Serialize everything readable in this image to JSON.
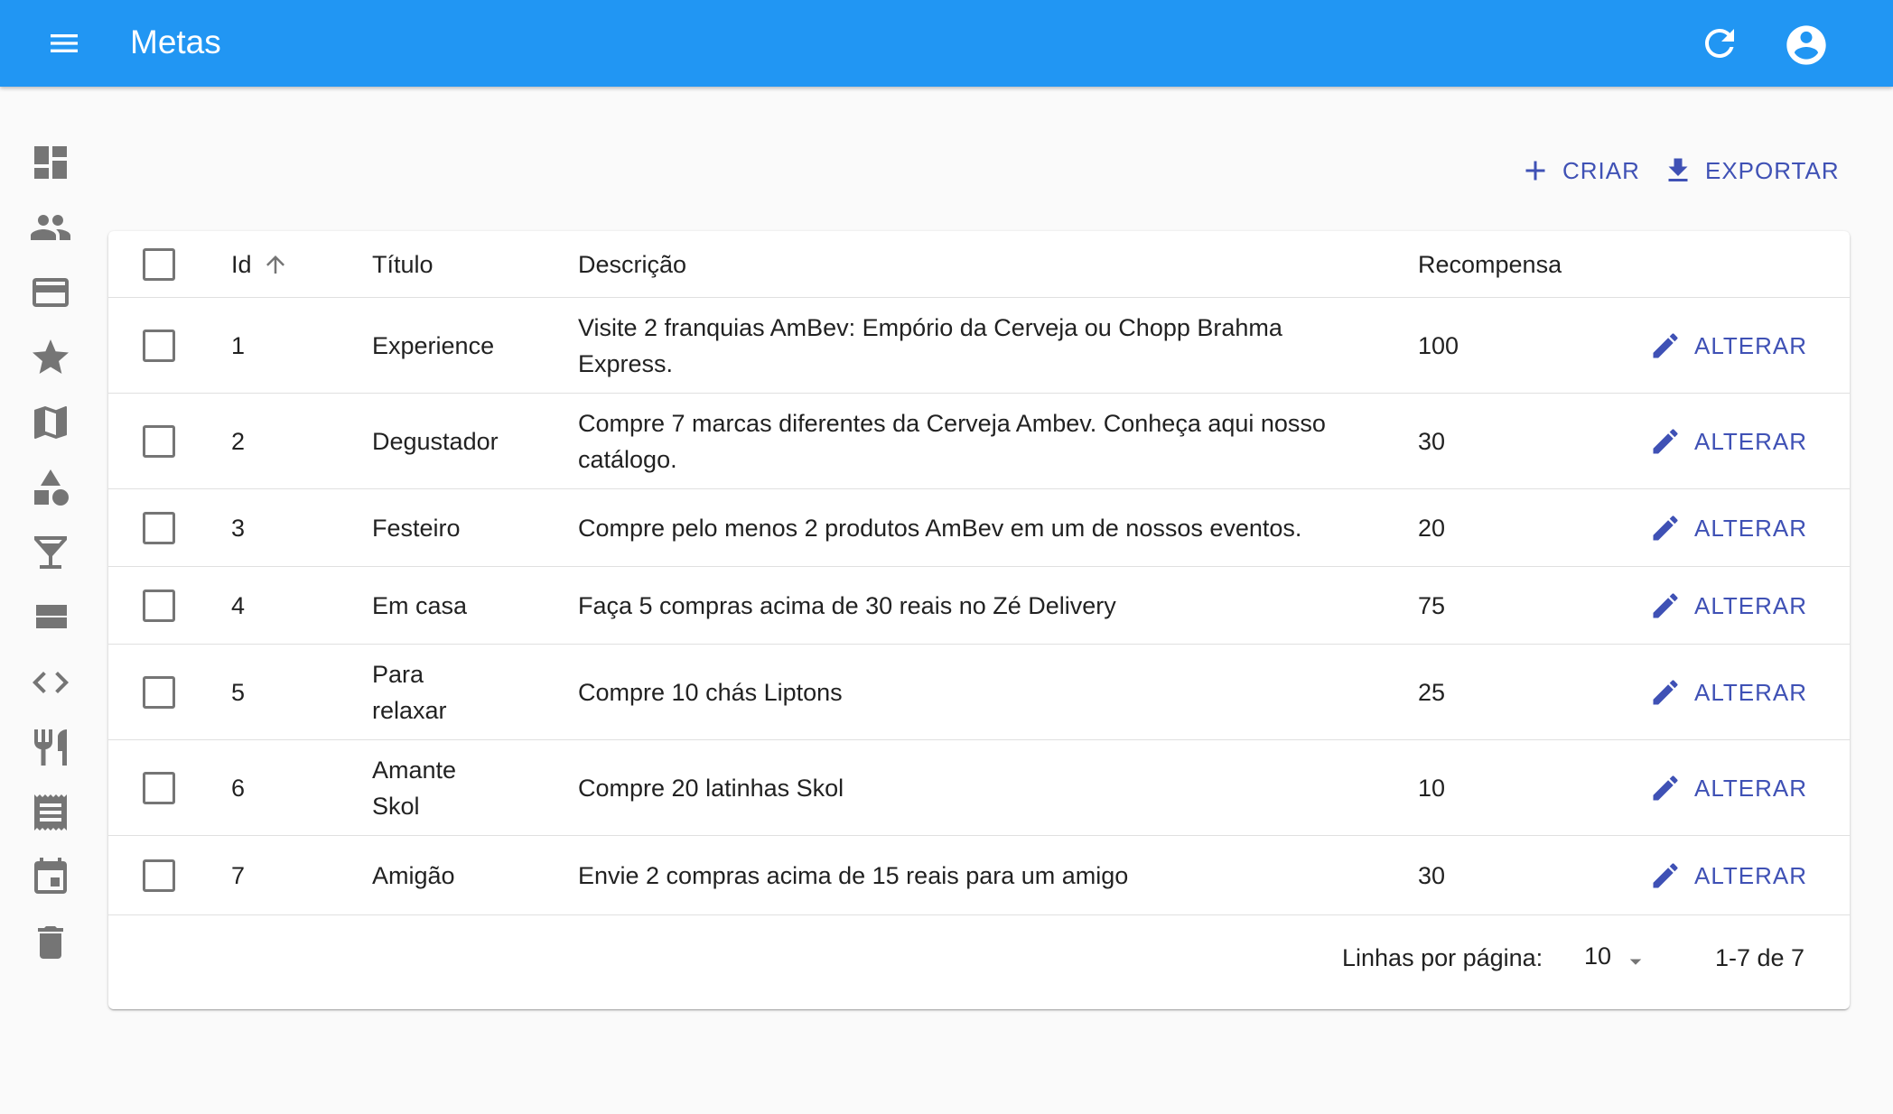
{
  "app": {
    "title": "Metas"
  },
  "appbar_icons": [
    "menu-icon",
    "refresh-icon",
    "account-circle-icon"
  ],
  "sidebar": {
    "icons": [
      "dashboard-icon",
      "people-icon",
      "credit-card-icon",
      "star-icon",
      "map-icon",
      "category-icon",
      "local-bar-icon",
      "view-stream-icon",
      "code-icon",
      "restaurant-icon",
      "receipt-icon",
      "event-icon",
      "delete-icon"
    ]
  },
  "actions": {
    "create_label": "CRIAR",
    "export_label": "EXPORTAR"
  },
  "table": {
    "columns": {
      "id": "Id",
      "title": "Título",
      "description": "Descrição",
      "reward": "Recompensa"
    },
    "sort": {
      "column": "id",
      "direction": "ascending"
    },
    "edit_label": "ALTERAR",
    "rows": [
      {
        "id": "1",
        "title": "Experience",
        "description": "Visite 2 franquias AmBev: Empório da Cerveja ou Chopp Brahma Express.",
        "reward": "100"
      },
      {
        "id": "2",
        "title": "Degustador",
        "description": "Compre 7 marcas diferentes da Cerveja Ambev. Conheça aqui nosso catálogo.",
        "reward": "30"
      },
      {
        "id": "3",
        "title": "Festeiro",
        "description": "Compre pelo menos 2 produtos AmBev em um de nossos eventos.",
        "reward": "20"
      },
      {
        "id": "4",
        "title": "Em casa",
        "description": "Faça 5 compras acima de 30 reais no Zé Delivery",
        "reward": "75"
      },
      {
        "id": "5",
        "title": "Para relaxar",
        "description": "Compre 10 chás Liptons",
        "reward": "25"
      },
      {
        "id": "6",
        "title": "Amante Skol",
        "description": "Compre 20 latinhas Skol",
        "reward": "10"
      },
      {
        "id": "7",
        "title": "Amigão",
        "description": "Envie 2 compras acima de 15 reais para um amigo",
        "reward": "30"
      }
    ]
  },
  "pagination": {
    "rows_per_page_label": "Linhas por página:",
    "rows_per_page": "10",
    "range": "1-7 de 7"
  },
  "colors": {
    "appbar": "#2196f3",
    "accent": "#3f51b5",
    "icon_grey": "#757575"
  }
}
